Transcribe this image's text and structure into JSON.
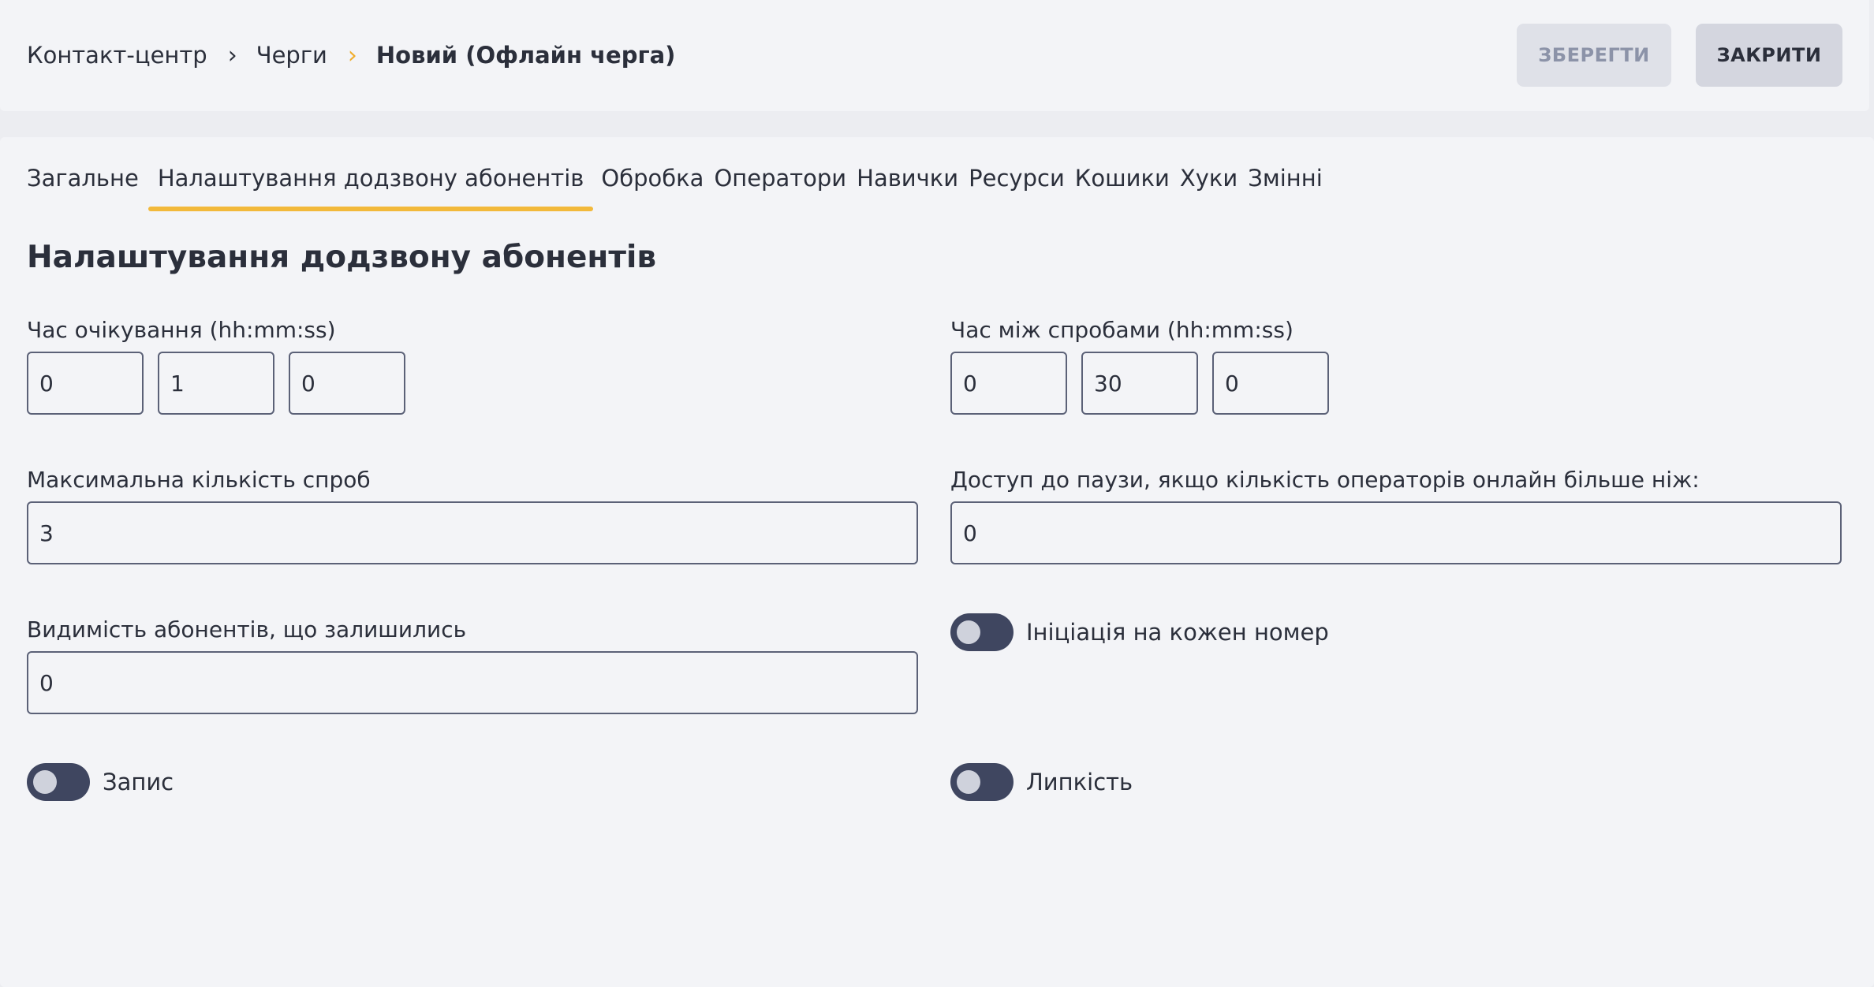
{
  "breadcrumb": {
    "items": [
      "Контакт-центр",
      "Черги"
    ],
    "current": "Новий (Офлайн черга)",
    "separator": "›"
  },
  "toolbar": {
    "save_label": "ЗБЕРЕГТИ",
    "close_label": "ЗАКРИТИ"
  },
  "tabs": [
    {
      "label": "Загальне",
      "active": false
    },
    {
      "label": "Налаштування додзвону абонентів",
      "active": true
    },
    {
      "label": "Обробка",
      "active": false
    },
    {
      "label": "Оператори",
      "active": false
    },
    {
      "label": "Навички",
      "active": false
    },
    {
      "label": "Ресурси",
      "active": false
    },
    {
      "label": "Кошики",
      "active": false
    },
    {
      "label": "Хуки",
      "active": false
    },
    {
      "label": "Змінні",
      "active": false
    }
  ],
  "section": {
    "title": "Налаштування додзвону абонентів"
  },
  "form": {
    "wait_time": {
      "label": "Час очікування (hh:mm:ss)",
      "hours": "0",
      "minutes": "1",
      "seconds": "0"
    },
    "retry_interval": {
      "label": "Час між спробами (hh:mm:ss)",
      "hours": "0",
      "minutes": "30",
      "seconds": "0"
    },
    "max_attempts": {
      "label": "Максимальна кількість спроб",
      "value": "3"
    },
    "pause_access": {
      "label": "Доступ до паузи, якщо кількість операторів онлайн більше ніж:",
      "value": "0"
    },
    "remaining_visibility": {
      "label": "Видимість абонентів, що залишились",
      "value": "0"
    },
    "initiation_per_number": {
      "label": "Ініціація на кожен номер",
      "enabled": false
    },
    "recording": {
      "label": "Запис",
      "enabled": false
    },
    "stickiness": {
      "label": "Липкість",
      "enabled": false
    }
  },
  "colors": {
    "accent": "#f2b93b",
    "toggle_track": "#3f4660",
    "input_border": "#5b6177"
  }
}
